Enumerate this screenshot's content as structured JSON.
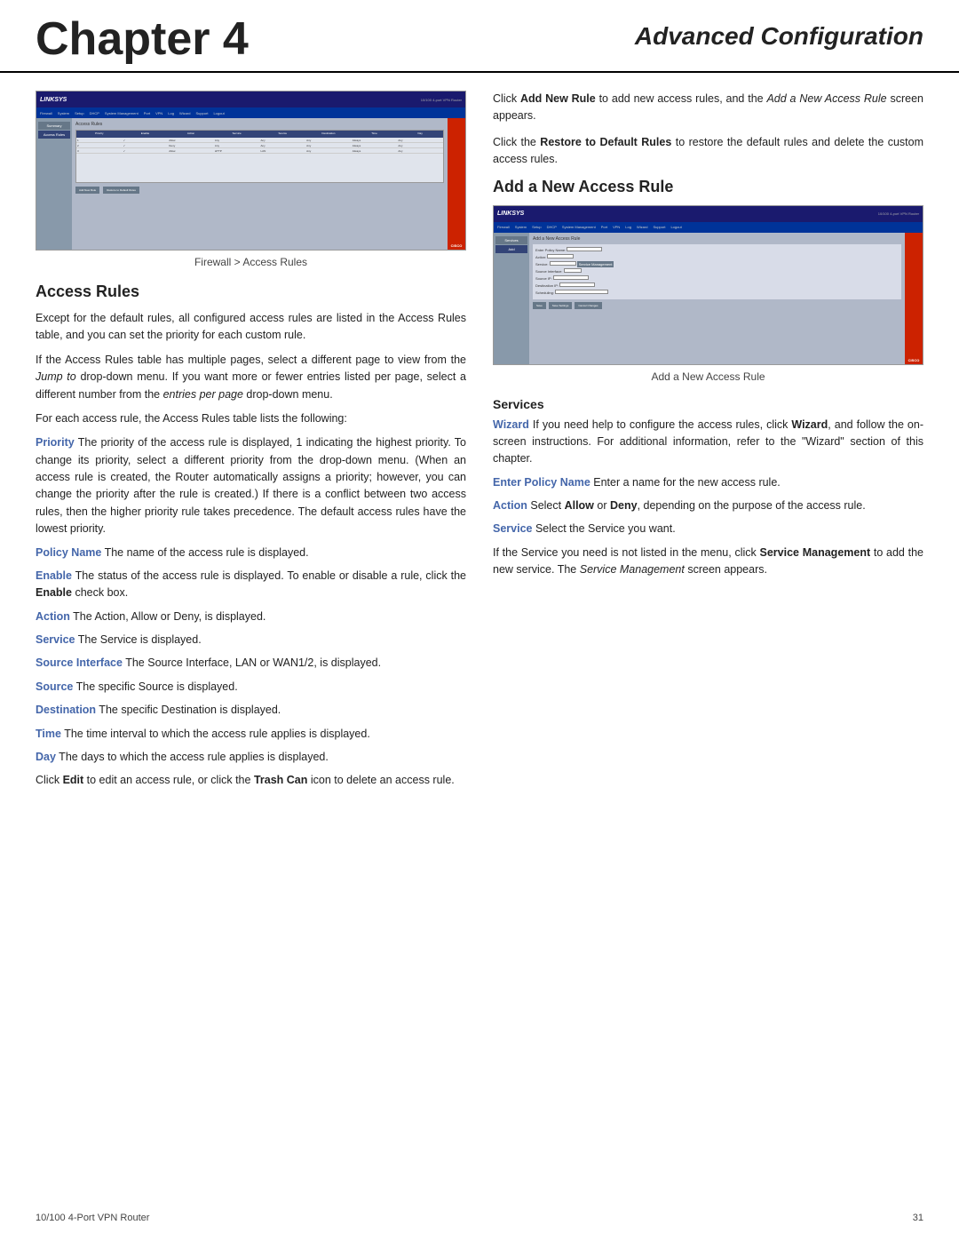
{
  "header": {
    "chapter_label": "Chapter 4",
    "section_label": "Advanced Configuration"
  },
  "footer": {
    "left_text": "10/100 4-Port VPN Router",
    "right_text": "31"
  },
  "left_column": {
    "screenshot_caption": "Firewall > Access Rules",
    "access_rules_heading": "Access Rules",
    "paragraphs": [
      "Except for the default rules, all configured access rules are listed in the Access Rules table, and you can set the priority for each custom rule.",
      "If the Access Rules table has multiple pages, select a different page to view from the Jump to drop-down menu. If you want more or fewer entries listed per page, select a different number from the entries per page drop-down menu.",
      "For each access rule, the Access Rules table lists the following:"
    ],
    "terms": [
      {
        "label": "Priority",
        "text": " The priority of the access rule is displayed, 1 indicating the highest priority. To change its priority, select a different priority from the drop-down menu. (When an access rule is created, the Router automatically assigns a priority; however, you can change the priority after the rule is created.) If there is a conflict between two access rules, then the higher priority rule takes precedence. The default access rules have the lowest priority."
      },
      {
        "label": "Policy Name",
        "text": "  The name of the access rule is displayed."
      },
      {
        "label": "Enable",
        "text": "  The status of the access rule is displayed. To enable or disable a rule, click the Enable check box.",
        "bold_word": "Enable"
      },
      {
        "label": "Action",
        "text": "  The Action, Allow or Deny, is displayed."
      },
      {
        "label": "Service",
        "text": "  The Service is displayed."
      },
      {
        "label": "Source Interface",
        "text": "  The Source Interface, LAN or WAN1/2, is displayed."
      },
      {
        "label": "Source",
        "text": "  The specific Source is displayed."
      },
      {
        "label": "Destination",
        "text": "  The specific Destination is displayed."
      },
      {
        "label": "Time",
        "text": "  The time interval to which the access rule applies is displayed."
      },
      {
        "label": "Day",
        "text": "  The days to which the access rule applies is displayed."
      }
    ],
    "edit_text": "Click Edit to edit an access rule, or click the Trash Can icon to delete an access rule.",
    "edit_bold1": "Edit",
    "edit_bold2": "Trash Can"
  },
  "right_column": {
    "intro_text1": "Click Add New Rule to add new access rules, and the Add a New Access Rule screen appears.",
    "intro_bold1": "Add New Rule",
    "intro_italic1": "Add a New Access Rule",
    "intro_text2": "Click the Restore to Default Rules to restore the default rules and delete the custom access rules.",
    "intro_bold2": "Restore to Default Rules",
    "add_rule_heading": "Add a New Access Rule",
    "screenshot_caption": "Add a New Access Rule",
    "services_heading": "Services",
    "services": [
      {
        "label": "Wizard",
        "text": "  If you need help to configure the access rules, click Wizard, and follow the on-screen instructions. For additional information, refer to the \"Wizard\" section of this chapter.",
        "bold_words": [
          "Wizard",
          "Wizard"
        ]
      },
      {
        "label": "Enter Policy Name",
        "text": "  Enter a name for the new access rule."
      },
      {
        "label": "Action",
        "text": "  Select Allow or Deny, depending on the purpose of the access rule.",
        "bold_words": [
          "Allow",
          "Deny"
        ]
      },
      {
        "label": "Service",
        "text": "  Select the Service you want."
      }
    ],
    "service_mgmt_text": "If the Service you need is not listed in the menu, click Service Management to add the new service. The Service Management screen appears.",
    "service_mgmt_bold": "Service Management",
    "service_mgmt_italic": "Service Management"
  }
}
